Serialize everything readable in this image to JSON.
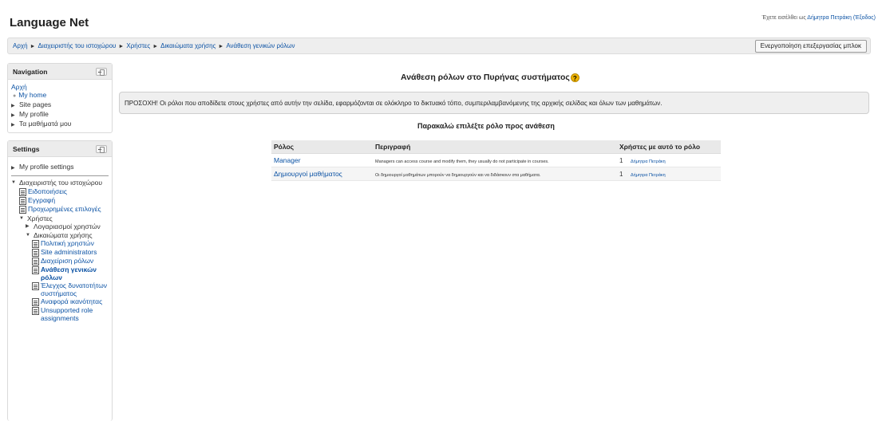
{
  "site": {
    "title": "Language Net",
    "login_prefix": "Έχετε εισέλθει ως ",
    "login_user": "Δήμητρα Πετράκη",
    "logout": "(Έξοδος)"
  },
  "navbar": {
    "breadcrumb": [
      "Αρχή",
      "Διαχειριστής του ιστοχώρου",
      "Χρήστες",
      "Δικαιώματα χρήσης",
      "Ανάθεση γενικών ρόλων"
    ],
    "separator": "►",
    "edit_button": "Ενεργοποίηση επεξεργασίας μπλοκ"
  },
  "navigation_block": {
    "title": "Navigation",
    "home": "Αρχή",
    "items": [
      {
        "label": "My home",
        "kind": "bullet"
      },
      {
        "label": "Site pages",
        "kind": "collapsed"
      },
      {
        "label": "My profile",
        "kind": "collapsed"
      },
      {
        "label": "Τα μαθήματά μου",
        "kind": "collapsed"
      }
    ]
  },
  "settings_block": {
    "title": "Settings",
    "my_profile": "My profile settings",
    "site_admin": "Διαχειριστής του ιστοχώρου",
    "admin_items": [
      "Ειδοποιήσεις",
      "Εγγραφή",
      "Προχωρημένες επιλογές"
    ],
    "users": "Χρήστες",
    "accounts": "Λογαριασμοί χρηστών",
    "permissions": "Δικαιώματα χρήσης",
    "permission_items": [
      {
        "label": "Πολιτική χρηστών",
        "current": false
      },
      {
        "label": "Site administrators",
        "current": false
      },
      {
        "label": "Διαχείριση ρόλων",
        "current": false
      },
      {
        "label": "Ανάθεση γενικών ρόλων",
        "current": true
      },
      {
        "label": "Έλεγχος δυνατοτήτων συστήματος",
        "current": false
      },
      {
        "label": "Αναφορά ικανότητας",
        "current": false
      },
      {
        "label": "Unsupported role assignments",
        "current": false
      }
    ]
  },
  "main": {
    "heading": "Ανάθεση ρόλων στο Πυρήνας συστήματος",
    "help_glyph": "?",
    "warning": "ΠΡΟΣΟΧΗ! Οι ρόλοι που αποδίδετε στους χρήστες από αυτήν την σελίδα, εφαρμόζονται σε ολόκληρο το δικτυακό τόπο, συμπεριλαμβανόμενης της αρχικής σελίδας και όλων των μαθημάτων.",
    "select_heading": "Παρακαλώ επιλέξτε ρόλο προς ανάθεση",
    "table": {
      "headers": [
        "Ρόλος",
        "Περιγραφή",
        "Χρήστες με αυτό το ρόλο"
      ],
      "rows": [
        {
          "role": "Manager",
          "description": "Managers can access course and modify them, they usually do not participate in courses.",
          "count": "1",
          "holder": "Δήμητρα Πετράκη"
        },
        {
          "role": "Δημιουργοί μαθήματος",
          "description": "Οι δημιουργοί μαθημάτων μπορούν να δημιουργούν και να διδάσκουν στα μαθήματα.",
          "count": "1",
          "holder": "Δήμητρα Πετράκη"
        }
      ]
    }
  }
}
